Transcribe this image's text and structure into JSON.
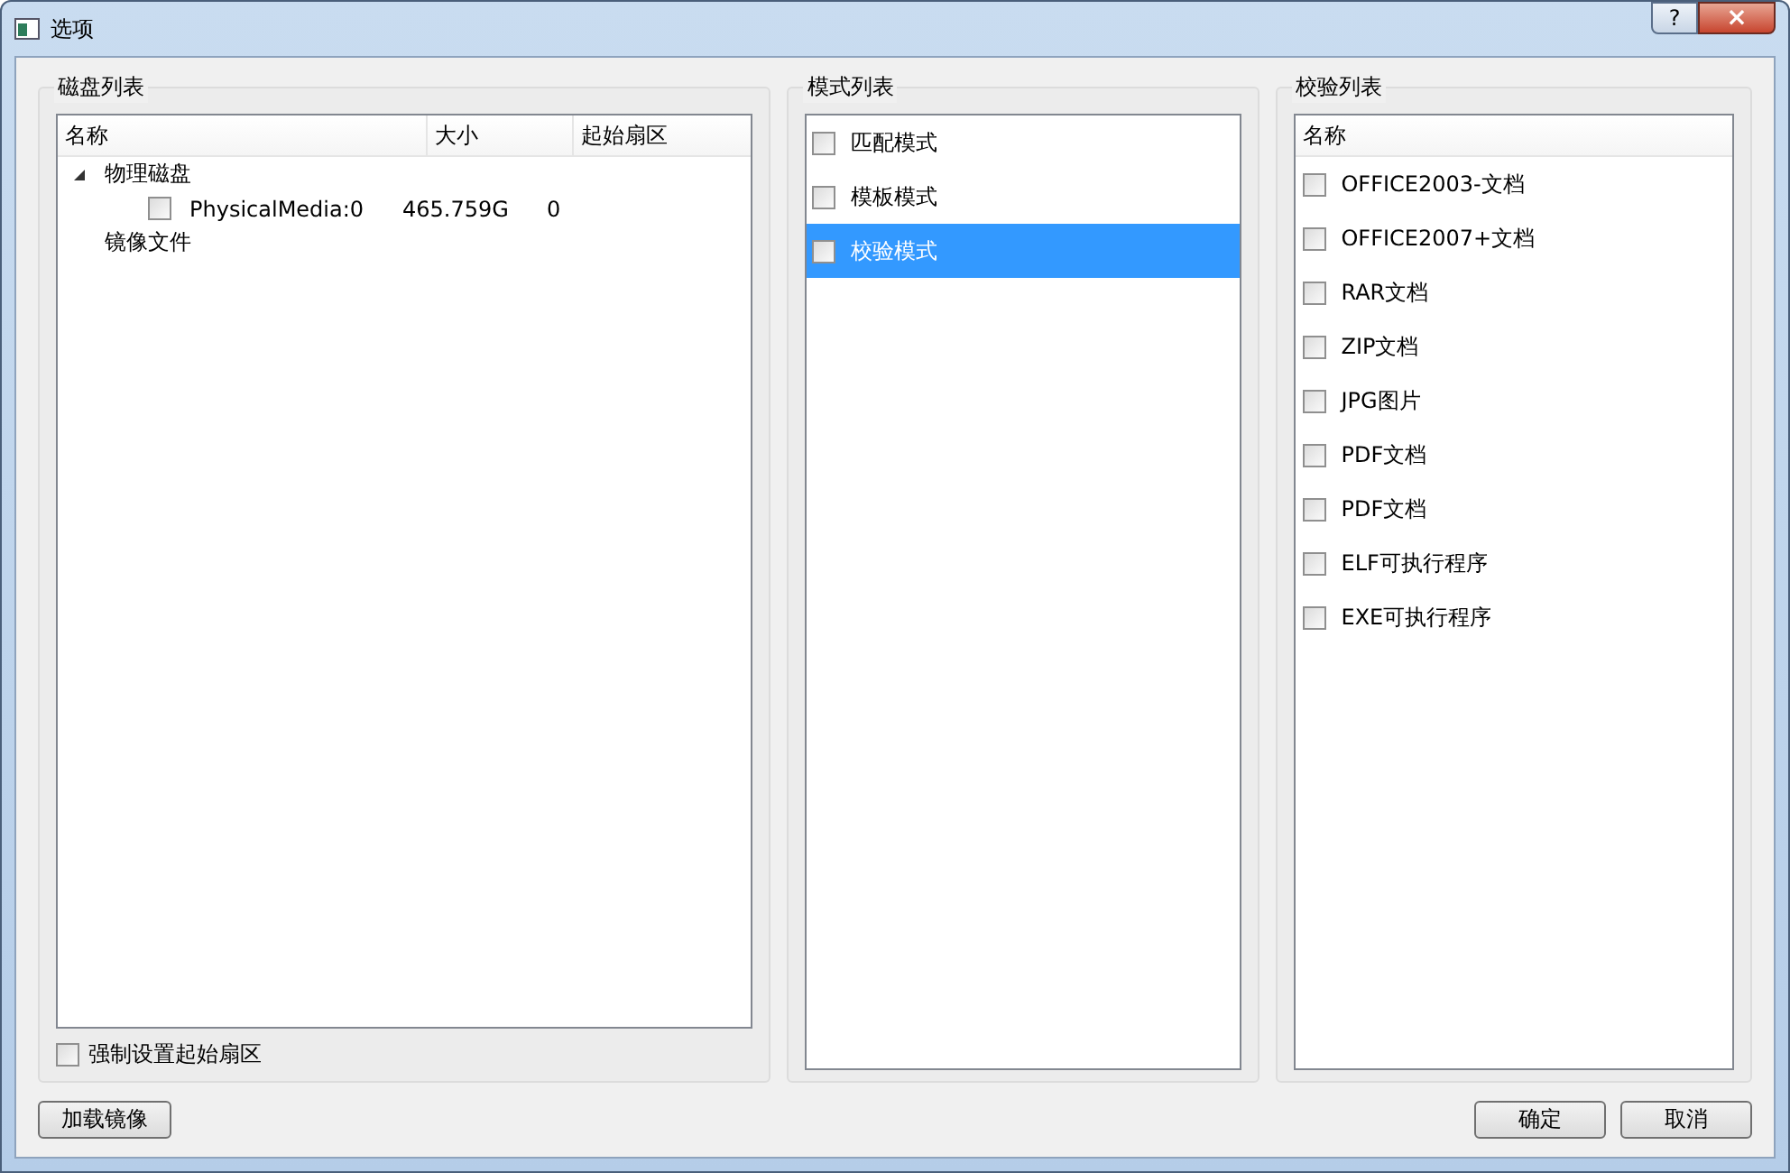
{
  "window": {
    "title": "选项",
    "help_button": "?",
    "close_button": "×"
  },
  "disk_group": {
    "title": "磁盘列表",
    "columns": [
      "名称",
      "大小",
      "起始扇区"
    ],
    "tree": [
      {
        "name": "物理磁盘",
        "expanded": true,
        "children": [
          {
            "name": "PhysicalMedia:0",
            "size": "465.759G",
            "start_sector": "0",
            "checked": false
          }
        ]
      },
      {
        "name": "镜像文件"
      }
    ],
    "force_option": {
      "label": "强制设置起始扇区",
      "checked": false
    }
  },
  "mode_group": {
    "title": "模式列表",
    "items": [
      {
        "label": "匹配模式",
        "checked": false,
        "selected": false
      },
      {
        "label": "模板模式",
        "checked": false,
        "selected": false
      },
      {
        "label": "校验模式",
        "checked": false,
        "selected": true
      }
    ]
  },
  "verify_group": {
    "title": "校验列表",
    "column": "名称",
    "items": [
      {
        "label": "OFFICE2003-文档",
        "checked": false
      },
      {
        "label": "OFFICE2007+文档",
        "checked": false
      },
      {
        "label": "RAR文档",
        "checked": false
      },
      {
        "label": "ZIP文档",
        "checked": false
      },
      {
        "label": "JPG图片",
        "checked": false
      },
      {
        "label": "PDF文档",
        "checked": false
      },
      {
        "label": "PDF文档",
        "checked": false
      },
      {
        "label": "ELF可执行程序",
        "checked": false
      },
      {
        "label": "EXE可执行程序",
        "checked": false
      }
    ]
  },
  "buttons": {
    "load_image": "加载镜像",
    "ok": "确定",
    "cancel": "取消"
  }
}
